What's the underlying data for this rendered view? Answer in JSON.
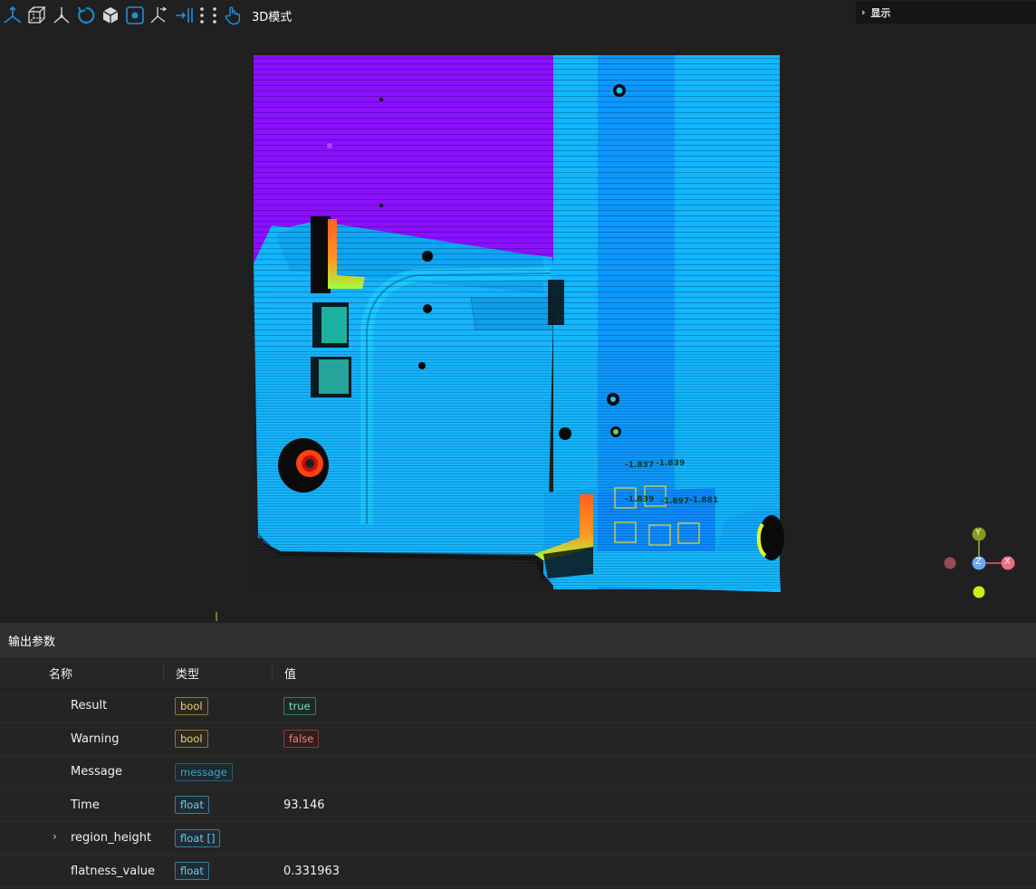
{
  "toolbar": {
    "icons": [
      "axes-icon",
      "cube-wireframe-icon",
      "axes-3d-icon",
      "rotate-reset-icon",
      "solid-cube-icon",
      "fit-view-icon",
      "measure-axis-icon",
      "align-icon",
      "points-icon",
      "pan-hand-icon"
    ],
    "mode_label": "3D模式",
    "accent": "#1e90d8"
  },
  "display_panel": {
    "label": "显示"
  },
  "viewport": {
    "measurements": [
      "-1.837",
      "-1.839",
      "-1.839",
      "-1.897",
      "-1.881"
    ],
    "axis_labels": {
      "x": "X",
      "y": "Y",
      "z": "Z"
    },
    "colors": {
      "purple": "#8a10ff",
      "cyan": "#0cb8ff",
      "blue": "#0c8cff",
      "box": "#e0d040"
    }
  },
  "output_panel": {
    "title": "输出参数",
    "headers": {
      "name": "名称",
      "type": "类型",
      "value": "值"
    },
    "rows": [
      {
        "name": "Result",
        "type": "bool",
        "value": "true"
      },
      {
        "name": "Warning",
        "type": "bool",
        "value": "false"
      },
      {
        "name": "Message",
        "type": "message",
        "value": ""
      },
      {
        "name": "Time",
        "type": "float",
        "value": "93.146"
      },
      {
        "name": "region_height",
        "type": "float []",
        "value": ""
      },
      {
        "name": "flatness_value",
        "type": "float",
        "value": "0.331963"
      }
    ]
  }
}
